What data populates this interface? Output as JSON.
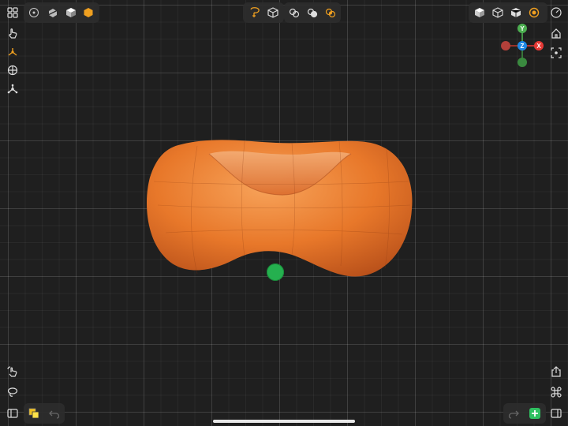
{
  "app": {
    "title": ""
  },
  "top_left": {
    "items": [
      {
        "icon": "grid-menu-icon"
      },
      {
        "icon": "sphere-wireframe-icon"
      },
      {
        "icon": "cube-slice-icon"
      },
      {
        "icon": "cube-solid-icon"
      },
      {
        "icon": "hexagon-orange-icon"
      }
    ]
  },
  "top_center": {
    "items": [
      {
        "icon": "lasso-select-icon"
      },
      {
        "icon": "cube-outline-icon"
      },
      {
        "icon": "boolean-union-icon"
      },
      {
        "icon": "boolean-subtract-icon"
      },
      {
        "icon": "boolean-intersect-icon"
      }
    ]
  },
  "top_right": {
    "items": [
      {
        "icon": "cube-shaded-icon"
      },
      {
        "icon": "cube-wire-icon"
      },
      {
        "icon": "cube-flat-icon"
      },
      {
        "icon": "material-sphere-icon"
      },
      {
        "icon": "speedometer-icon"
      }
    ]
  },
  "right_column": {
    "items": [
      {
        "icon": "home-icon"
      },
      {
        "icon": "frame-selection-icon"
      }
    ]
  },
  "left_tools": {
    "items": [
      {
        "icon": "hand-touch-icon"
      },
      {
        "icon": "transform-gizmo-icon"
      },
      {
        "icon": "pivot-icon"
      },
      {
        "icon": "snap-icon"
      }
    ]
  },
  "gizmo": {
    "axes": [
      {
        "label": "Y",
        "color": "#4caf50"
      },
      {
        "label": "X",
        "color": "#e53935"
      },
      {
        "label": "Z",
        "color": "#1e88e5"
      }
    ]
  },
  "bottom_left": {
    "items": [
      {
        "icon": "hand-select-icon"
      },
      {
        "icon": "lasso-icon"
      },
      {
        "icon": "sidebar-icon"
      },
      {
        "icon": "color-swatch-icon"
      },
      {
        "icon": "undo-icon"
      }
    ]
  },
  "bottom_right": {
    "items": [
      {
        "icon": "share-icon"
      },
      {
        "icon": "command-icon"
      },
      {
        "icon": "redo-icon"
      },
      {
        "icon": "add-object-icon"
      },
      {
        "icon": "right-sidebar-icon"
      }
    ]
  },
  "colors": {
    "accent": "#f0a020",
    "object": "#e8782a",
    "add_button": "#2fc060",
    "handle": "#25b04f"
  }
}
